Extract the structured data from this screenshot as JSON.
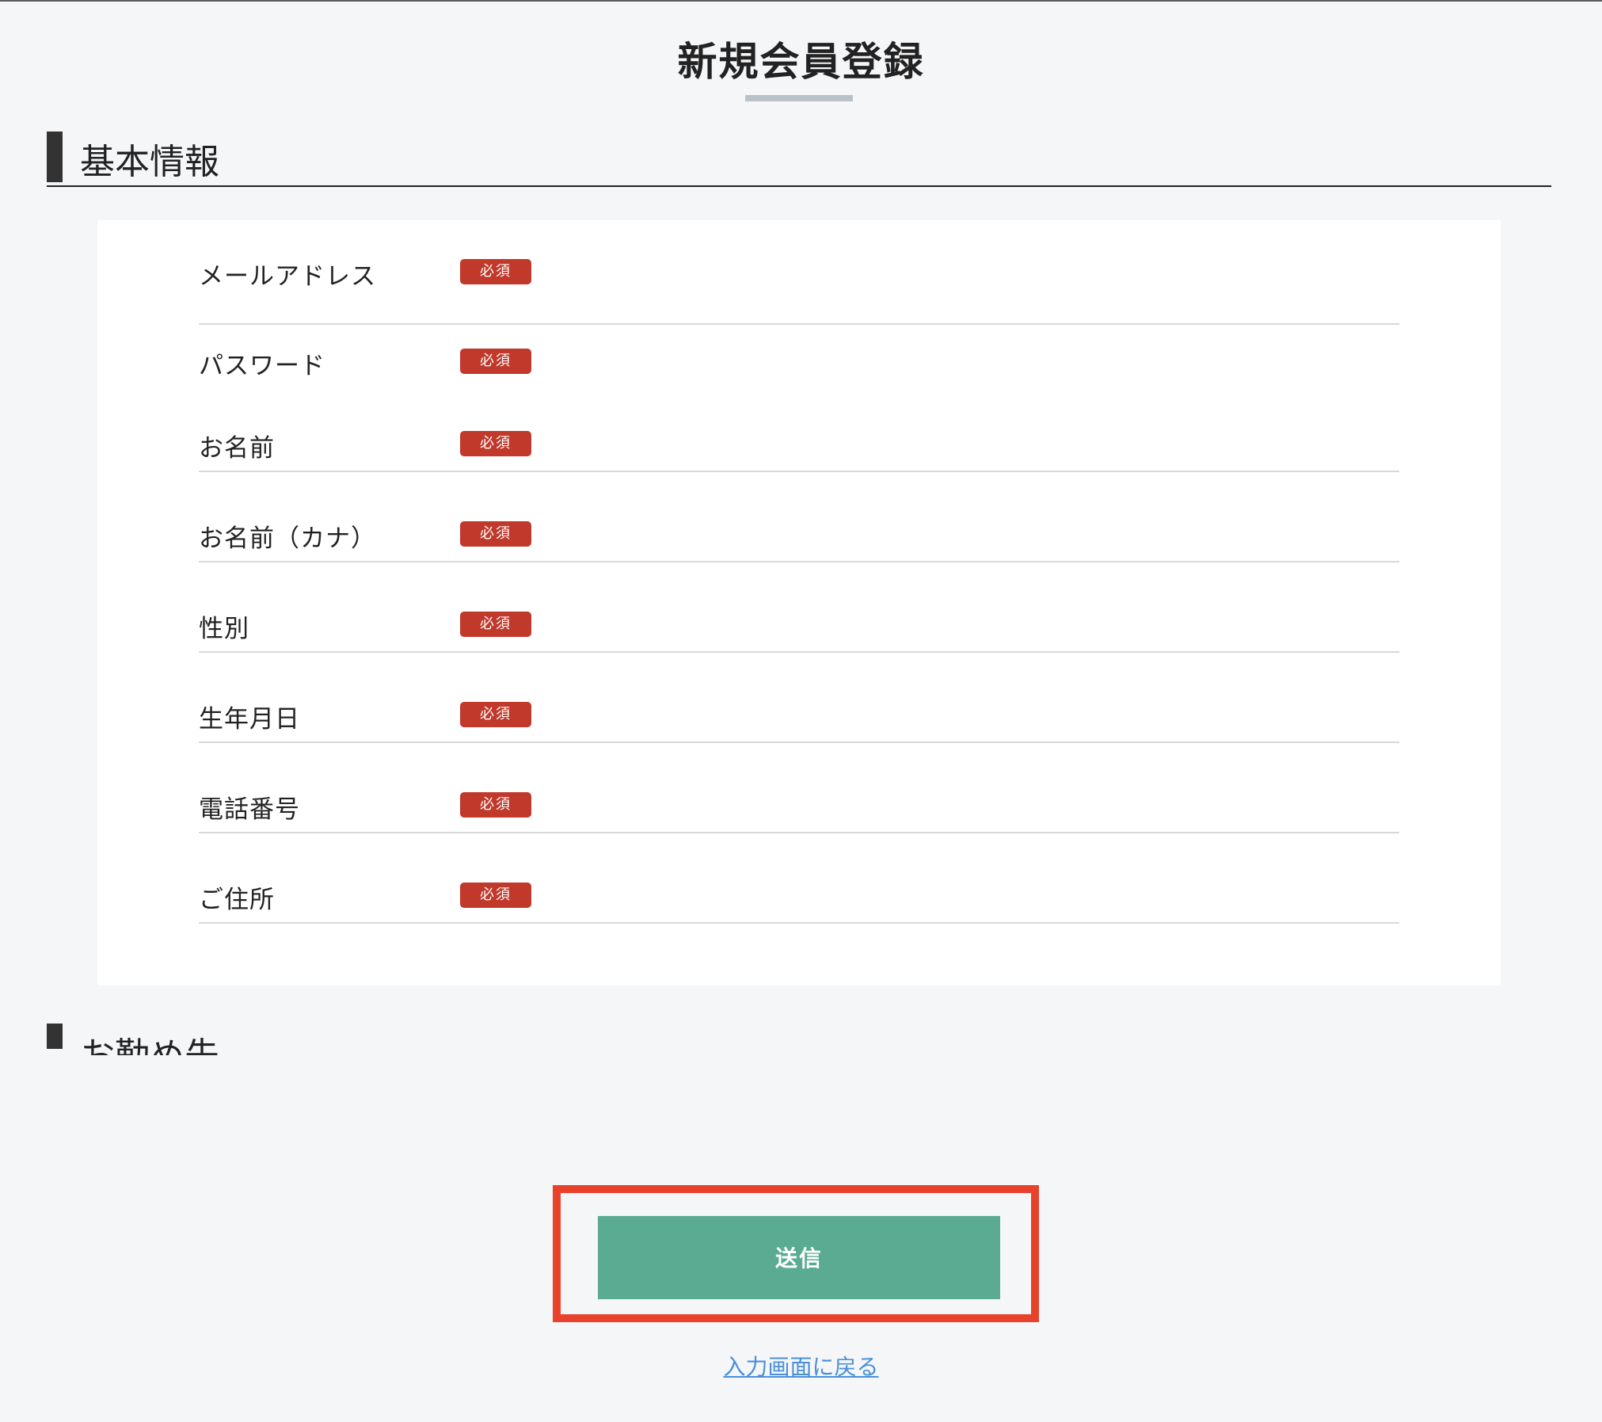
{
  "page": {
    "title": "新規会員登録"
  },
  "sections": {
    "basic": {
      "heading": "基本情報"
    },
    "work": {
      "heading": "お勤め先"
    }
  },
  "form": {
    "required_label": "必須",
    "rows": [
      {
        "label": "メールアドレス"
      },
      {
        "label": "パスワード"
      },
      {
        "label": "お名前"
      },
      {
        "label": "お名前（カナ）"
      },
      {
        "label": "性別"
      },
      {
        "label": "生年月日"
      },
      {
        "label": "電話番号"
      },
      {
        "label": "ご住所"
      }
    ]
  },
  "actions": {
    "submit_label": "送信",
    "back_link_label": "入力画面に戻る"
  },
  "colors": {
    "required_badge": "#c0392b",
    "submit_button": "#5aab92",
    "highlight_frame": "#e8412c",
    "link": "#4a90d9"
  }
}
